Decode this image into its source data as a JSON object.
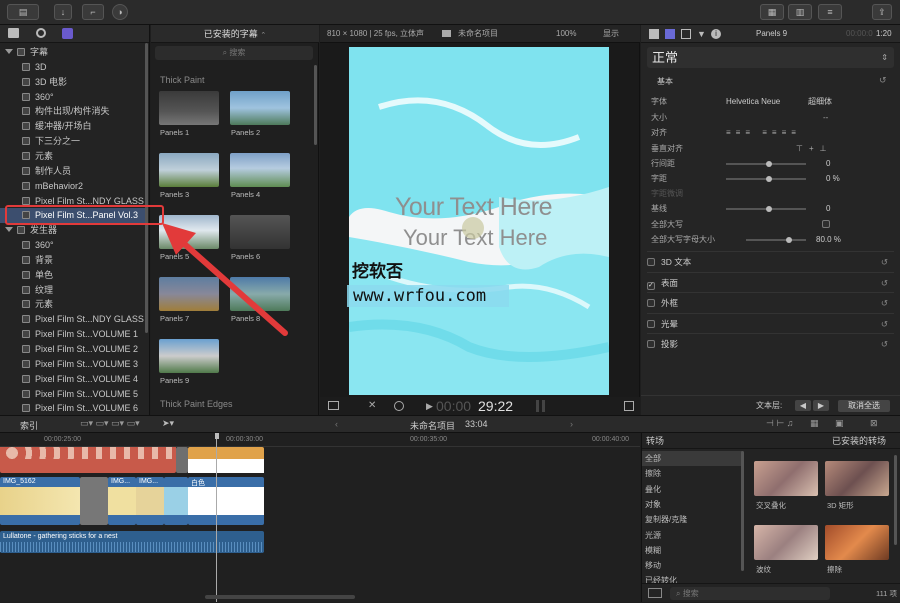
{
  "library": {
    "toolbar_icons": [
      "clapper-icon",
      "music-icon",
      "title-icon"
    ],
    "items": [
      {
        "label": "字幕",
        "category": true
      },
      {
        "label": "3D"
      },
      {
        "label": "3D 电影"
      },
      {
        "label": "360°"
      },
      {
        "label": "构件出现/构件消失"
      },
      {
        "label": "缓冲器/开场白"
      },
      {
        "label": "下三分之一"
      },
      {
        "label": "元素"
      },
      {
        "label": "制作人员"
      },
      {
        "label": "mBehavior2"
      },
      {
        "label": "Pixel Film St...NDY GLASS"
      },
      {
        "label": "Pixel Film St...Panel Vol.3",
        "selected": true
      },
      {
        "label": "发生器",
        "category": true
      },
      {
        "label": "360°"
      },
      {
        "label": "背景"
      },
      {
        "label": "单色"
      },
      {
        "label": "纹理"
      },
      {
        "label": "元素"
      },
      {
        "label": "Pixel Film St...NDY GLASS"
      },
      {
        "label": "Pixel Film St...VOLUME 1"
      },
      {
        "label": "Pixel Film St...VOLUME 2"
      },
      {
        "label": "Pixel Film St...VOLUME 3"
      },
      {
        "label": "Pixel Film St...VOLUME 4"
      },
      {
        "label": "Pixel Film St...VOLUME 5"
      },
      {
        "label": "Pixel Film St...VOLUME 6"
      }
    ]
  },
  "browser": {
    "title": "已安装的字幕",
    "search_placeholder": "搜索",
    "section1": "Thick Paint",
    "section2": "Thick Paint Edges",
    "thumbs": [
      "Panels 1",
      "Panels 2",
      "Panels 3",
      "Panels 4",
      "Panels 5",
      "Panels 6",
      "Panels 7",
      "Panels 8",
      "Panels 9"
    ]
  },
  "viewer": {
    "format": "810 × 1080 | 25 fps, 立体声",
    "project": "未命名项目",
    "zoom": "100%",
    "display": "显示",
    "text_line1": "Your Text Here",
    "text_line2": "Your Text Here",
    "watermark_name": "挖软否",
    "watermark_url": "www.wrfou.com",
    "timecode_dim": "00:00",
    "timecode": "29:22"
  },
  "inspector": {
    "title": "Panels 9",
    "duration_dim": "00:00:0",
    "duration": "1:20",
    "preset": "正常",
    "basic": "基本",
    "font_label": "字体",
    "font_value": "Helvetica Neue",
    "weight_value": "超细体",
    "size_label": "大小",
    "size_value": "--",
    "align_label": "对齐",
    "valign_label": "垂直对齐",
    "line_spacing_label": "行间距",
    "line_spacing_value": "0",
    "tracking_label": "字距",
    "tracking_value": "0 %",
    "kerning_label": "字距微调",
    "baseline_label": "基线",
    "baseline_value": "0",
    "allcaps_label": "全部大写",
    "allcaps_size_label": "全部大写字母大小",
    "allcaps_size_value": "80.0 %",
    "sections": [
      "3D 文本",
      "表面",
      "外框",
      "光晕",
      "投影"
    ],
    "text_layer": "文本层:",
    "deselect_all": "取消全选"
  },
  "timeline_bar": {
    "index": "索引",
    "project": "未命名项目",
    "duration": "33:04",
    "transitions_label": "转场",
    "installed": "已安装的转场"
  },
  "timeline": {
    "ruler": [
      "00:00:25:00",
      "00:00:30:00",
      "00:00:35:00",
      "00:00:40:00"
    ],
    "clip1": "IMG_5162",
    "clip2": "IMG...",
    "clip3": "IMG...",
    "clip4": "白色",
    "audio": "Lullatone - gathering sticks for a nest"
  },
  "transitions": {
    "categories": [
      "全部",
      "擦除",
      "叠化",
      "对象",
      "复制器/克隆",
      "光源",
      "模糊",
      "移动",
      "已经转化"
    ],
    "items": [
      "交叉叠化",
      "3D 矩形",
      "波纹",
      "擦除"
    ],
    "search_placeholder": "搜索",
    "count": "111 项"
  },
  "colors": {
    "accent": "#e23a3a",
    "selection": "#3c4e6e",
    "paint": "#7fe3ef"
  }
}
